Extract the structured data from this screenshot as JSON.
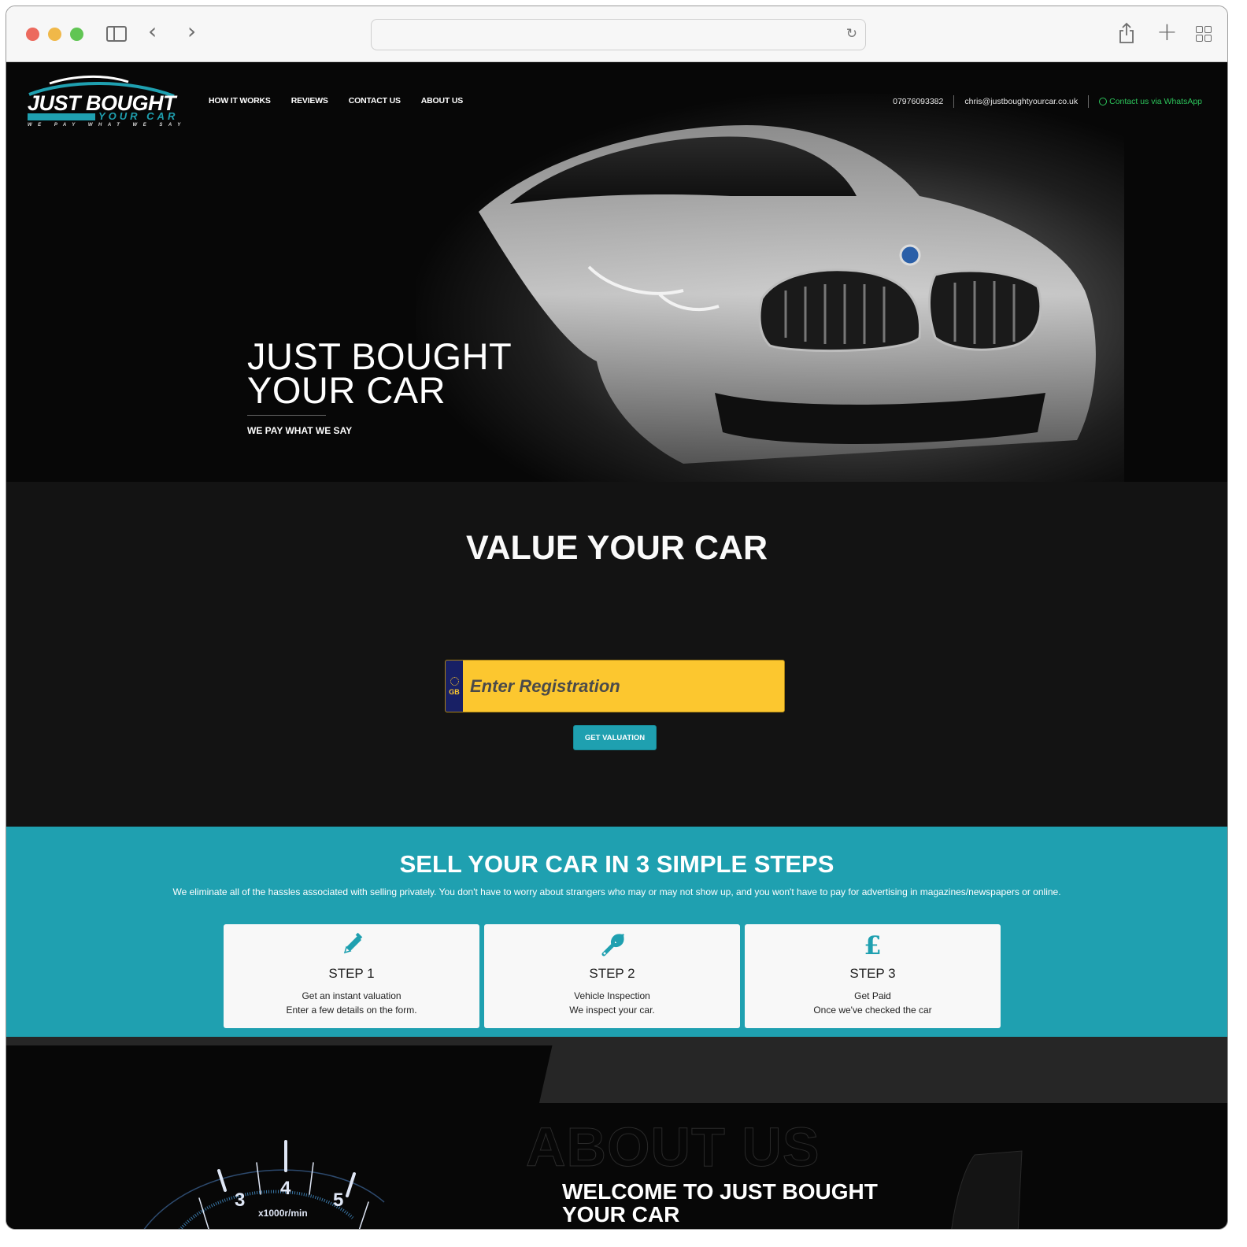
{
  "browser": {
    "url": "",
    "icons": [
      "sidebar-toggle-icon",
      "back-arrow-icon",
      "forward-arrow-icon",
      "reload-icon",
      "share-icon",
      "new-tab-plus-icon",
      "tab-overview-icon"
    ]
  },
  "header": {
    "logo": {
      "main": "JUST BOUGHT",
      "sub": "YOUR CAR",
      "tagline": "WE PAY WHAT WE SAY"
    },
    "nav": [
      {
        "label": "HOW IT WORKS"
      },
      {
        "label": "REVIEWS"
      },
      {
        "label": "CONTACT US"
      },
      {
        "label": "ABOUT US"
      }
    ],
    "contact": {
      "phone": "07976093382",
      "email": "chris@justboughtyourcar.co.uk",
      "whatsapp": "Contact us via WhatsApp",
      "whatsapp_color": "#2cc35a"
    }
  },
  "hero": {
    "title_line1": "JUST BOUGHT",
    "title_line2": "YOUR CAR",
    "tagline": "WE PAY WHAT WE SAY"
  },
  "valuation": {
    "title": "VALUE YOUR CAR",
    "plate_country": "GB",
    "registration_placeholder": "Enter Registration",
    "registration_value": "",
    "button_label": "GET VALUATION",
    "plate_color": "#fcc72f",
    "plate_band_color": "#182065"
  },
  "steps": {
    "title": "SELL YOUR CAR IN 3 SIMPLE STEPS",
    "description": "We eliminate all of the hassles associated with selling privately. You don't have to worry about strangers who may or may not show up, and you won't have to pay for advertising in magazines/newspapers or online.",
    "accent_color": "#1fa0b0",
    "items": [
      {
        "icon": "pencil-icon",
        "title": "STEP 1",
        "line1": "Get an instant valuation",
        "line2": "Enter a few details on the form."
      },
      {
        "icon": "wrench-icon",
        "title": "STEP 2",
        "line1": "Vehicle Inspection",
        "line2": "We inspect your car."
      },
      {
        "icon": "pound-icon",
        "title": "STEP 3",
        "line1": "Get Paid",
        "line2": "Once we've checked the car"
      }
    ]
  },
  "about": {
    "ghost_title": "ABOUT US",
    "welcome": "WELCOME TO JUST BOUGHT YOUR CAR",
    "gauge_labels": [
      "3",
      "4",
      "5"
    ],
    "gauge_unit": "x1000r/min"
  }
}
